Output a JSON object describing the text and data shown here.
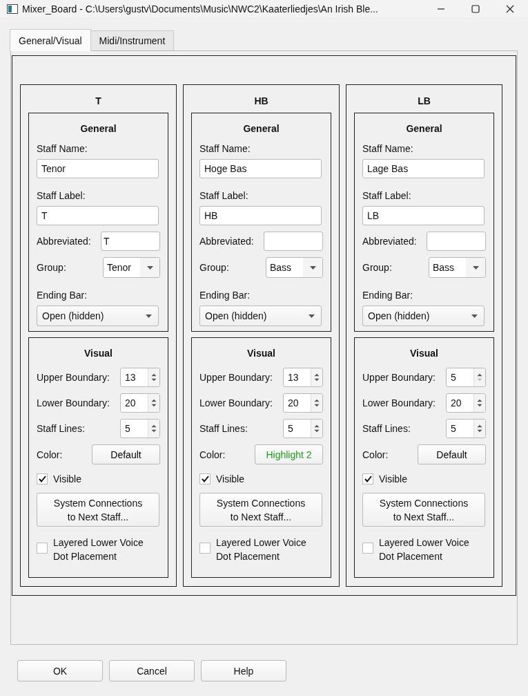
{
  "window": {
    "title": "Mixer_Board - C:\\Users\\gustv\\Documents\\Music\\NWC2\\Kaaterliedjes\\An Irish Ble..."
  },
  "tabs": [
    {
      "label": "General/Visual",
      "selected": true
    },
    {
      "label": "Midi/Instrument",
      "selected": false
    }
  ],
  "staves": [
    {
      "title": "T",
      "general": {
        "heading": "General",
        "name_label": "Staff Name:",
        "name": "Tenor",
        "label_label": "Staff Label:",
        "label": "T",
        "abbrev_label": "Abbreviated:",
        "abbrev": "T",
        "group_label": "Group:",
        "group": "Tenor",
        "ending_label": "Ending Bar:",
        "ending": "Open (hidden)"
      },
      "visual": {
        "heading": "Visual",
        "upper_label": "Upper Boundary:",
        "upper": {
          "value": "13",
          "down_disabled": false
        },
        "lower_label": "Lower Boundary:",
        "lower": "20",
        "lines_label": "Staff Lines:",
        "lines": "5",
        "color_label": "Color:",
        "color": {
          "text": "Default",
          "color": "#000000"
        },
        "visible": {
          "label": "Visible",
          "checked": true
        },
        "connections": "System Connections to Next Staff...",
        "layered": {
          "label": "Layered Lower Voice Dot Placement",
          "checked": false
        }
      }
    },
    {
      "title": "HB",
      "general": {
        "heading": "General",
        "name_label": "Staff Name:",
        "name": "Hoge Bas",
        "label_label": "Staff Label:",
        "label": "HB",
        "abbrev_label": "Abbreviated:",
        "group_label": "Group:",
        "group": "Bass",
        "ending_label": "Ending Bar:",
        "ending": "Open (hidden)"
      },
      "visual": {
        "heading": "Visual",
        "upper_label": "Upper Boundary:",
        "upper": {
          "value": "13",
          "down_disabled": false
        },
        "lower_label": "Lower Boundary:",
        "lower": "20",
        "lines_label": "Staff Lines:",
        "lines": "5",
        "color_label": "Color:",
        "color": {
          "text": "Highlight 2",
          "color": "#1e9e1e"
        },
        "visible": {
          "label": "Visible",
          "checked": true
        },
        "connections": "System Connections to Next Staff...",
        "layered": {
          "label": "Layered Lower Voice Dot Placement",
          "checked": false
        }
      }
    },
    {
      "title": "LB",
      "general": {
        "heading": "General",
        "name_label": "Staff Name:",
        "name": "Lage Bas",
        "label_label": "Staff Label:",
        "label": "LB",
        "abbrev_label": "Abbreviated:",
        "group_label": "Group:",
        "group": "Bass",
        "ending_label": "Ending Bar:",
        "ending": "Open (hidden)"
      },
      "visual": {
        "heading": "Visual",
        "upper_label": "Upper Boundary:",
        "upper": {
          "value": "5",
          "down_disabled": true
        },
        "lower_label": "Lower Boundary:",
        "lower": "20",
        "lines_label": "Staff Lines:",
        "lines": "5",
        "color_label": "Color:",
        "color": {
          "text": "Default",
          "color": "#000000"
        },
        "visible": {
          "label": "Visible",
          "checked": true
        },
        "connections": "System Connections to Next Staff...",
        "layered": {
          "label": "Layered Lower Voice Dot Placement",
          "checked": false
        }
      }
    }
  ],
  "buttons": [
    "OK",
    "Cancel",
    "Help"
  ]
}
